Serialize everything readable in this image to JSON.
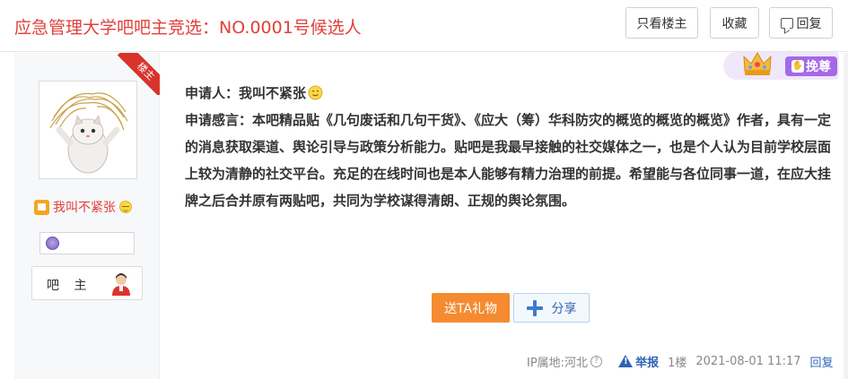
{
  "header": {
    "title": "应急管理大学吧吧主竞选：NO.0001号候选人",
    "buttons": {
      "only_op": "只看楼主",
      "favorite": "收藏",
      "reply": "回复"
    }
  },
  "author": {
    "corner_tag": "楼主",
    "name": "我叫不紧张",
    "role": "吧 主"
  },
  "tip_badge": {
    "label": "挽尊"
  },
  "post": {
    "applicant_line": "申请人：我叫不紧张",
    "statement": "申请感言：本吧精品贴《几句废话和几句干货》、《应大（筹）华科防灾的概览的概览的概览》作者，具有一定的消息获取渠道、舆论引导与政策分析能力。贴吧是我最早接触的社交媒体之一，也是个人认为目前学校层面上较为清静的社交平台。充足的在线时间也是本人能够有精力治理的前提。希望能与各位同事一道，在应大挂牌之后合并原有两贴吧，共同为学校谋得清朗、正规的舆论氛围。"
  },
  "actions": {
    "gift": "送TA礼物",
    "share": "分享"
  },
  "meta": {
    "ip": "IP属地:河北",
    "q_icon": "?",
    "report": "举报",
    "floor": "1楼",
    "time": "2021-08-01 11:17",
    "reply": "回复"
  },
  "colors": {
    "title_red": "#e1403a",
    "link_blue": "#2d64b3",
    "gift_orange": "#f48b30",
    "tip_purple": "#a468e8"
  }
}
